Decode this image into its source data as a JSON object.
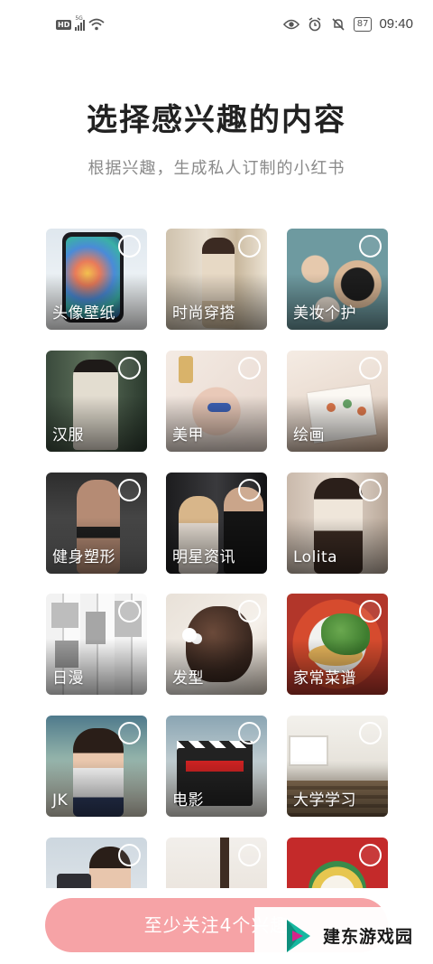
{
  "status_bar": {
    "hd_label": "HD",
    "network_label": "5G",
    "battery": "87",
    "time": "09:40",
    "icons": [
      "eye-icon",
      "alarm-icon",
      "mute-icon"
    ]
  },
  "header": {
    "title": "选择感兴趣的内容",
    "subtitle": "根据兴趣，生成私人订制的小红书"
  },
  "categories": [
    {
      "label": "头像壁纸"
    },
    {
      "label": "时尚穿搭"
    },
    {
      "label": "美妆个护"
    },
    {
      "label": "汉服"
    },
    {
      "label": "美甲"
    },
    {
      "label": "绘画"
    },
    {
      "label": "健身塑形"
    },
    {
      "label": "明星资讯"
    },
    {
      "label": "Lolita"
    },
    {
      "label": "日漫"
    },
    {
      "label": "发型"
    },
    {
      "label": "家常菜谱"
    },
    {
      "label": "JK"
    },
    {
      "label": "电影"
    },
    {
      "label": "大学学习"
    },
    {
      "label": ""
    },
    {
      "label": ""
    },
    {
      "label": ""
    }
  ],
  "cta": {
    "label": "至少关注4个兴趣"
  },
  "watermark": {
    "text": "建东游戏园"
  },
  "colors": {
    "cta_bg": "#f6a3a6",
    "title": "#222222",
    "subtitle": "#8a8a8a",
    "accent": "#ff2442"
  }
}
